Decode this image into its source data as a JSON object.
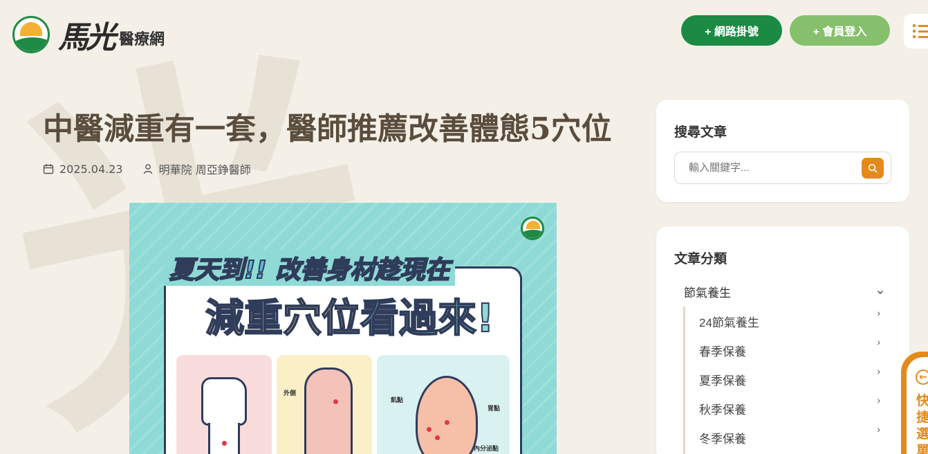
{
  "header": {
    "logo_script": "馬光",
    "logo_sub": "醫療網",
    "register_button": "+ 網路掛號",
    "login_button": "+ 會員登入",
    "menu_icon": "list-menu-icon"
  },
  "watermark": "光",
  "article": {
    "title": "中醫減重有一套，醫師推薦改善體態5穴位",
    "date": "2025.04.23",
    "author": "明華院 周亞錚醫師",
    "poster": {
      "subtitle": "夏天到!! 改善身材趁現在",
      "main_yellow": "減重穴位",
      "main_teal": "看過來!",
      "arm_label": "外側",
      "ear_label_left": "飢點",
      "ear_label_right": "胃點",
      "ear_label_bottom": "內分泌點"
    }
  },
  "sidebar": {
    "search_title": "搜尋文章",
    "search_placeholder": "輸入關鍵字...",
    "category_title": "文章分類",
    "category_parent": "節氣養生",
    "category_items": [
      "24節氣養生",
      "春季保養",
      "夏季保養",
      "秋季保養",
      "冬季保養"
    ]
  },
  "quick_menu": {
    "label": "快捷選單"
  },
  "colors": {
    "brand_green": "#1b8a42",
    "light_green": "#86c06c",
    "accent_orange": "#e38a1a",
    "background": "#f4f0e8",
    "title_brown": "#5a4d3d"
  }
}
